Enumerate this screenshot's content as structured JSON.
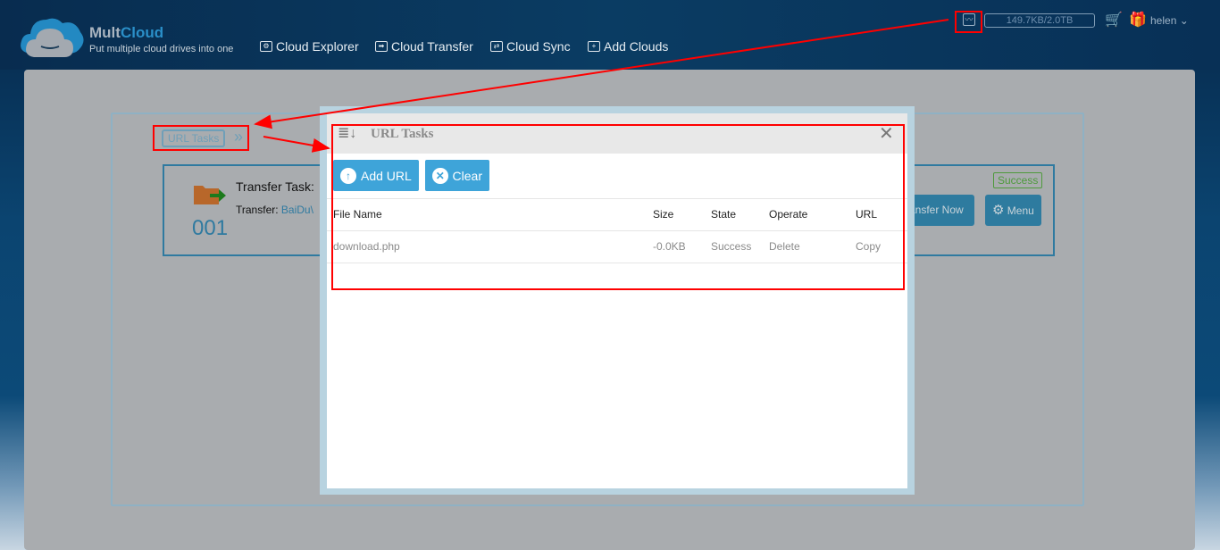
{
  "header": {
    "brand_a": "Mult",
    "brand_b": "Cloud",
    "tagline": "Put multiple cloud drives into one",
    "nav": [
      {
        "label": "Cloud Explorer",
        "icon": "explorer-icon"
      },
      {
        "label": "Cloud Transfer",
        "icon": "transfer-icon"
      },
      {
        "label": "Cloud Sync",
        "icon": "sync-icon"
      },
      {
        "label": "Add Clouds",
        "icon": "add-icon"
      }
    ],
    "quota": "149.7KB/2.0TB",
    "user": "helen"
  },
  "background": {
    "breadcrumb": "URL Tasks",
    "task": {
      "number": "001",
      "title": "Transfer Task: ",
      "transfer_label": "Transfer: ",
      "transfer_value": "BaiDu\\",
      "status": "Success",
      "transfer_now": "ansfer Now",
      "menu": "Menu"
    }
  },
  "modal": {
    "title": "URL Tasks",
    "add_url": "Add URL",
    "clear": "Clear",
    "columns": [
      "File Name",
      "Size",
      "State",
      "Operate",
      "URL"
    ],
    "rows": [
      {
        "file": "download.php",
        "size": "-0.0KB",
        "state": "Success",
        "operate": "Delete",
        "url": "Copy"
      }
    ]
  },
  "colors": {
    "accent": "#3ea4d9",
    "annotation": "#ff0000",
    "success": "#4e9a3c"
  }
}
